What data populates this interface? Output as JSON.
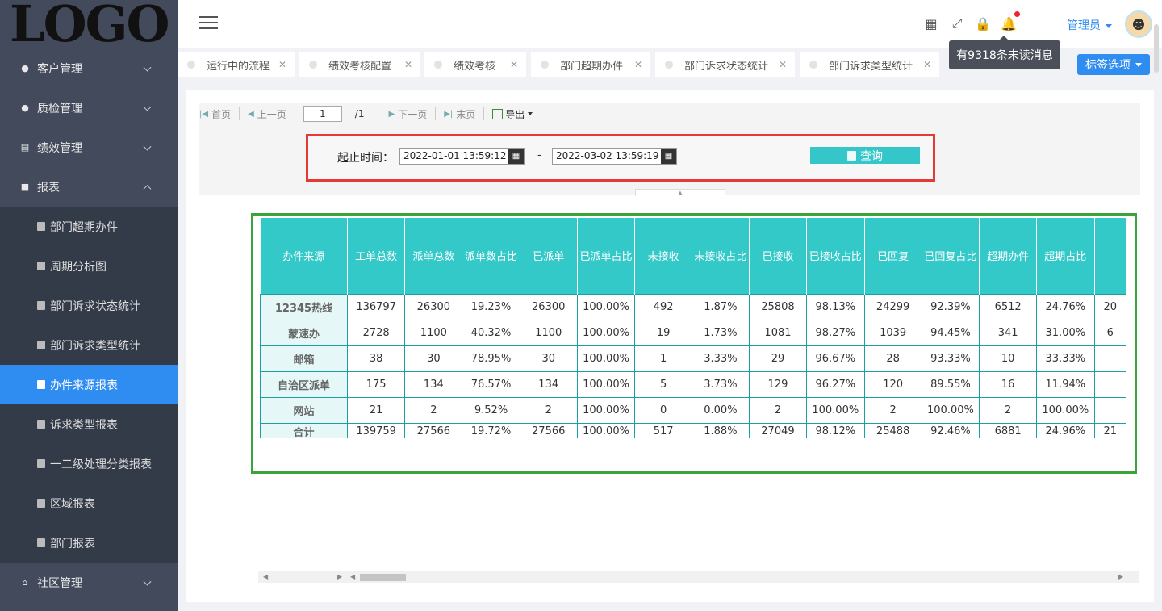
{
  "logo": "LOGO",
  "sidebar": {
    "items": [
      {
        "label": "客户管理",
        "icon": "users-icon",
        "expanded": false
      },
      {
        "label": "质检管理",
        "icon": "info-icon",
        "expanded": false
      },
      {
        "label": "绩效管理",
        "icon": "chart-icon",
        "expanded": false
      },
      {
        "label": "报表",
        "icon": "folder-icon",
        "expanded": true
      }
    ],
    "submenu": [
      {
        "label": "部门超期办件"
      },
      {
        "label": "周期分析图"
      },
      {
        "label": "部门诉求状态统计"
      },
      {
        "label": "部门诉求类型统计"
      },
      {
        "label": "办件来源报表",
        "active": true
      },
      {
        "label": "诉求类型报表"
      },
      {
        "label": "一二级处理分类报表"
      },
      {
        "label": "区域报表"
      },
      {
        "label": "部门报表"
      }
    ],
    "bottom": {
      "label": "社区管理",
      "icon": "home-icon"
    }
  },
  "header": {
    "admin_label": "管理员",
    "tooltip": "有9318条未读消息"
  },
  "tabs": [
    {
      "label": "运行中的流程"
    },
    {
      "label": "绩效考核配置"
    },
    {
      "label": "绩效考核"
    },
    {
      "label": "部门超期办件"
    },
    {
      "label": "部门诉求状态统计"
    },
    {
      "label": "部门诉求类型统计"
    }
  ],
  "tab_options_label": "标签选项",
  "toolbar": {
    "first": "首页",
    "prev": "上一页",
    "page": "1",
    "total": "/1",
    "next": "下一页",
    "last": "末页",
    "export": "导出"
  },
  "filter": {
    "label": "起止时间：",
    "start": "2022-01-01 13:59:12",
    "end": "2022-03-02 13:59:19",
    "dash": "-",
    "query_label": "查询"
  },
  "table": {
    "headers": [
      "办件来源",
      "工单总数",
      "派单总数",
      "派单数占比",
      "已派单",
      "已派单占比",
      "未接收",
      "未接收占比",
      "已接收",
      "已接收占比",
      "已回复",
      "已回复占比",
      "超期办件",
      "超期占比",
      ""
    ],
    "rows": [
      [
        "12345热线",
        "136797",
        "26300",
        "19.23%",
        "26300",
        "100.00%",
        "492",
        "1.87%",
        "25808",
        "98.13%",
        "24299",
        "92.39%",
        "6512",
        "24.76%",
        "20"
      ],
      [
        "蒙速办",
        "2728",
        "1100",
        "40.32%",
        "1100",
        "100.00%",
        "19",
        "1.73%",
        "1081",
        "98.27%",
        "1039",
        "94.45%",
        "341",
        "31.00%",
        "6"
      ],
      [
        "邮箱",
        "38",
        "30",
        "78.95%",
        "30",
        "100.00%",
        "1",
        "3.33%",
        "29",
        "96.67%",
        "28",
        "93.33%",
        "10",
        "33.33%",
        ""
      ],
      [
        "自治区派单",
        "175",
        "134",
        "76.57%",
        "134",
        "100.00%",
        "5",
        "3.73%",
        "129",
        "96.27%",
        "120",
        "89.55%",
        "16",
        "11.94%",
        ""
      ],
      [
        "网站",
        "21",
        "2",
        "9.52%",
        "2",
        "100.00%",
        "0",
        "0.00%",
        "2",
        "100.00%",
        "2",
        "100.00%",
        "2",
        "100.00%",
        ""
      ]
    ],
    "total": [
      "合计",
      "139759",
      "27566",
      "19.72%",
      "27566",
      "100.00%",
      "517",
      "1.88%",
      "27049",
      "98.12%",
      "25488",
      "92.46%",
      "6881",
      "24.96%",
      "21"
    ]
  }
}
